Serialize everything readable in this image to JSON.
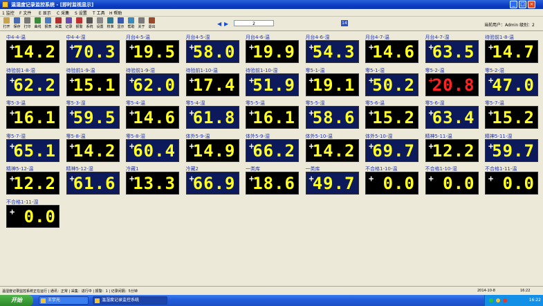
{
  "window": {
    "title": "温湿度记录监控系统 - [即时监视显示]",
    "controls": {
      "minimize": "_",
      "maximize": "□",
      "close": "×"
    }
  },
  "menu": [
    {
      "label": "1 监控"
    },
    {
      "label": "F 文件"
    },
    {
      "label": "E 显示"
    },
    {
      "label": "C 采集"
    },
    {
      "label": "S 设置"
    },
    {
      "label": "T 工具"
    },
    {
      "label": "H 帮助"
    }
  ],
  "toolbar": {
    "tools": [
      {
        "label": "打开",
        "icon": "open-icon",
        "color": "#caa24a"
      },
      {
        "label": "保存",
        "icon": "save-icon",
        "color": "#4a6ab0"
      },
      {
        "label": "打印",
        "icon": "print-icon",
        "color": "#777777"
      },
      {
        "label": "曲线",
        "icon": "curve-icon",
        "color": "#3a8a3a"
      },
      {
        "label": "报表",
        "icon": "report-icon",
        "color": "#4a7ac0"
      },
      {
        "label": "采集",
        "icon": "collect-icon",
        "color": "#b03030"
      },
      {
        "label": "记录",
        "icon": "record-icon",
        "color": "#6a4ab0"
      },
      {
        "label": "报警",
        "icon": "alarm-icon",
        "color": "#c03030"
      },
      {
        "label": "系统",
        "icon": "system-icon",
        "color": "#555555"
      },
      {
        "label": "设置",
        "icon": "settings-icon",
        "color": "#8a8a8a"
      },
      {
        "label": "校准",
        "icon": "calibrate-icon",
        "color": "#2a7a9a"
      },
      {
        "label": "显示",
        "icon": "display-icon",
        "color": "#3a5ab0"
      },
      {
        "label": "帮助",
        "icon": "help-icon",
        "color": "#3a8ac0"
      },
      {
        "label": "关于",
        "icon": "about-icon",
        "color": "#7a7a7a"
      },
      {
        "label": "退出",
        "icon": "exit-icon",
        "color": "#9a4a2a"
      }
    ],
    "page_value": "2",
    "selected_count": "14",
    "user_info": "当前用户：Admin  级别：2"
  },
  "gauges": [
    {
      "label": "中4-4-温",
      "value": "14.2",
      "bg": "black"
    },
    {
      "label": "中4-4-湿",
      "value": "70.3",
      "bg": "navy"
    },
    {
      "label": "月台4-5-温",
      "value": "19.5",
      "bg": "black"
    },
    {
      "label": "月台4-5-湿",
      "value": "58.0",
      "bg": "navy"
    },
    {
      "label": "月台4-6-温",
      "value": "19.9",
      "bg": "black"
    },
    {
      "label": "月台4-6-湿",
      "value": "54.3",
      "bg": "navy"
    },
    {
      "label": "月台4-7-温",
      "value": "14.6",
      "bg": "black"
    },
    {
      "label": "月台4-7-湿",
      "value": "63.5",
      "bg": "navy"
    },
    {
      "label": "待验前1-8-温",
      "value": "14.7",
      "bg": "black"
    },
    {
      "label": "待验前1-8-湿",
      "value": "62.2",
      "bg": "navy"
    },
    {
      "label": "待验前1-9-温",
      "value": "15.1",
      "bg": "black"
    },
    {
      "label": "待验前1-9-湿",
      "value": "62.0",
      "bg": "navy"
    },
    {
      "label": "待验前1-10-温",
      "value": "17.4",
      "bg": "black"
    },
    {
      "label": "待验前1-10-湿",
      "value": "51.9",
      "bg": "navy"
    },
    {
      "label": "零5-1-温",
      "value": "19.1",
      "bg": "black"
    },
    {
      "label": "零5-1-湿",
      "value": "50.2",
      "bg": "navy"
    },
    {
      "label": "零5-2-温",
      "value": "20.8",
      "bg": "black",
      "alarm": true
    },
    {
      "label": "零5-2-湿",
      "value": "47.0",
      "bg": "navy"
    },
    {
      "label": "零5-3-温",
      "value": "16.1",
      "bg": "black"
    },
    {
      "label": "零5-3-湿",
      "value": "59.5",
      "bg": "navy"
    },
    {
      "label": "零5-4-温",
      "value": "14.6",
      "bg": "black"
    },
    {
      "label": "零5-4-湿",
      "value": "61.8",
      "bg": "navy"
    },
    {
      "label": "零5-5-温",
      "value": "16.1",
      "bg": "black"
    },
    {
      "label": "零5-5-湿",
      "value": "58.6",
      "bg": "navy"
    },
    {
      "label": "零5-6-温",
      "value": "15.2",
      "bg": "black"
    },
    {
      "label": "零5-6-湿",
      "value": "63.4",
      "bg": "navy"
    },
    {
      "label": "零5-7-温",
      "value": "15.2",
      "bg": "black"
    },
    {
      "label": "零5-7-湿",
      "value": "65.1",
      "bg": "navy"
    },
    {
      "label": "零5-8-温",
      "value": "14.2",
      "bg": "black"
    },
    {
      "label": "零5-8-湿",
      "value": "60.4",
      "bg": "navy"
    },
    {
      "label": "体外5-9-温",
      "value": "14.9",
      "bg": "black"
    },
    {
      "label": "体外5-9-湿",
      "value": "66.2",
      "bg": "navy"
    },
    {
      "label": "体外5-10-温",
      "value": "14.2",
      "bg": "black"
    },
    {
      "label": "体外5-10-湿",
      "value": "69.7",
      "bg": "navy"
    },
    {
      "label": "精神5-11-温",
      "value": "12.2",
      "bg": "black"
    },
    {
      "label": "精神5-11-湿",
      "value": "59.7",
      "bg": "navy"
    },
    {
      "label": "精神5-12-温",
      "value": "12.2",
      "bg": "black"
    },
    {
      "label": "精神5-12-湿",
      "value": "61.6",
      "bg": "navy"
    },
    {
      "label": "冷藏1",
      "value": "13.3",
      "bg": "black"
    },
    {
      "label": "冷藏2",
      "value": "66.9",
      "bg": "navy"
    },
    {
      "label": "一类库",
      "value": "18.6",
      "bg": "black"
    },
    {
      "label": "一类库",
      "value": "49.7",
      "bg": "navy"
    },
    {
      "label": "不合格1-10-温",
      "value": "0.0",
      "bg": "black"
    },
    {
      "label": "不合格1-10-湿",
      "value": "0.0",
      "bg": "black"
    },
    {
      "label": "不合格1-11-温",
      "value": "0.0",
      "bg": "black"
    },
    {
      "label": "不合格1-11-湿",
      "value": "0.0",
      "bg": "black"
    }
  ],
  "colors": {
    "lcd_black": "#000000",
    "lcd_navy": "#0c1a5c",
    "digit_yellow": "#ffff22",
    "alarm_red": "#ff2222"
  },
  "statusbar": {
    "text": "温湿度记录监控系统正在运行 | 通讯：正常 | 采集：进行中 | 报警：1 | 记录间隔：5分钟",
    "date": "2014-10-8",
    "time": "16:22"
  },
  "taskbar": {
    "start_label": "开始",
    "tasks": [
      {
        "label": "王宇光"
      },
      {
        "label": "温湿度记录监控系统"
      }
    ],
    "clock": "16:22"
  }
}
